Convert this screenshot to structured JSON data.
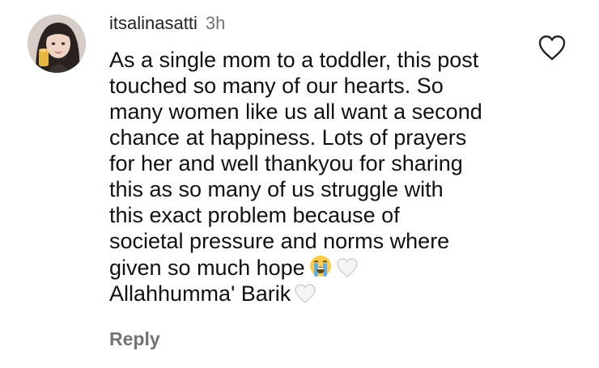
{
  "comment": {
    "username": "itsalinasatti",
    "time": "3h",
    "lines": [
      "As a single mom to a toddler, this post",
      "touched so many of our hearts. So",
      "many women like us all want a second",
      "chance at happiness. Lots of prayers",
      "for her and well thankyou for sharing",
      "this as so many of us struggle with",
      "this exact problem because of",
      "societal pressure and norms where",
      "given so much hope",
      "Allahhumma' Barik"
    ],
    "reply_label": "Reply"
  },
  "icons": {
    "like": "heart-outline-icon",
    "crying": "loudly-crying-face-emoji",
    "heart": "white-heart-emoji"
  },
  "colors": {
    "text": "#111111",
    "muted": "#737373",
    "background": "#ffffff"
  }
}
